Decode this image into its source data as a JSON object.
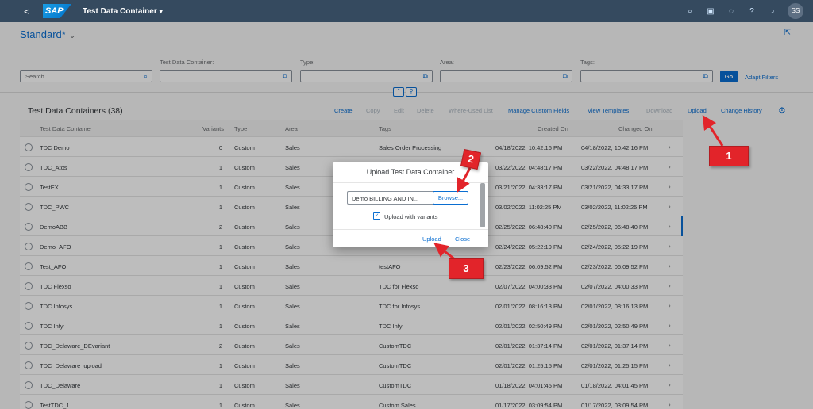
{
  "shell": {
    "back_label": "<",
    "logo_text": "SAP",
    "app_title": "Test Data Container",
    "app_title_caret": "▾",
    "icons": [
      "search-icon",
      "copilot-icon",
      "help-icon",
      "question-icon",
      "notification-icon"
    ],
    "avatar": "SS"
  },
  "header": {
    "variant": "Standard*",
    "variant_chevron": "⌄"
  },
  "filters": {
    "search_placeholder": "Search",
    "labels": [
      "Test Data Container:",
      "Type:",
      "Area:",
      "Tags:"
    ],
    "go": "Go",
    "adapt": "Adapt Filters"
  },
  "table": {
    "title": "Test Data Containers (38)",
    "toolbar": [
      {
        "label": "Create",
        "enabled": true
      },
      {
        "label": "Copy",
        "enabled": false
      },
      {
        "label": "Edit",
        "enabled": false
      },
      {
        "label": "Delete",
        "enabled": false
      },
      {
        "label": "Where-Used List",
        "enabled": false
      },
      {
        "label": "Manage Custom Fields",
        "enabled": true
      },
      {
        "label": "View Templates",
        "enabled": true
      },
      {
        "label": "Download",
        "enabled": false
      },
      {
        "label": "Upload",
        "enabled": true
      },
      {
        "label": "Change History",
        "enabled": true
      }
    ],
    "columns": [
      "Test Data Container",
      "Variants",
      "Type",
      "Area",
      "Tags",
      "Created On",
      "Changed On"
    ],
    "rows": [
      {
        "name": "TDC Demo",
        "variants": "0",
        "type": "Custom",
        "area": "Sales",
        "tags": "Sales Order Processing",
        "created": "04/18/2022, 10:42:16 PM",
        "changed": "04/18/2022, 10:42:16 PM"
      },
      {
        "name": "TDC_Atos",
        "variants": "1",
        "type": "Custom",
        "area": "Sales",
        "tags": "",
        "created": "03/22/2022, 04:48:17 PM",
        "changed": "03/22/2022, 04:48:17 PM"
      },
      {
        "name": "TestEX",
        "variants": "1",
        "type": "Custom",
        "area": "Sales",
        "tags": "",
        "created": "03/21/2022, 04:33:17 PM",
        "changed": "03/21/2022, 04:33:17 PM"
      },
      {
        "name": "TDC_PWC",
        "variants": "1",
        "type": "Custom",
        "area": "Sales",
        "tags": "",
        "created": "03/02/2022, 11:02:25 PM",
        "changed": "03/02/2022, 11:02:25 PM"
      },
      {
        "name": "DemoABB",
        "variants": "2",
        "type": "Custom",
        "area": "Sales",
        "tags": "",
        "created": "02/25/2022, 06:48:40 PM",
        "changed": "02/25/2022, 06:48:40 PM"
      },
      {
        "name": "Demo_AFO",
        "variants": "1",
        "type": "Custom",
        "area": "Sales",
        "tags": "",
        "created": "02/24/2022, 05:22:19 PM",
        "changed": "02/24/2022, 05:22:19 PM"
      },
      {
        "name": "Test_AFO",
        "variants": "1",
        "type": "Custom",
        "area": "Sales",
        "tags": "testAFO",
        "created": "02/23/2022, 06:09:52 PM",
        "changed": "02/23/2022, 06:09:52 PM"
      },
      {
        "name": "TDC Flexso",
        "variants": "1",
        "type": "Custom",
        "area": "Sales",
        "tags": "TDC for Flexso",
        "created": "02/07/2022, 04:00:33 PM",
        "changed": "02/07/2022, 04:00:33 PM"
      },
      {
        "name": "TDC Infosys",
        "variants": "1",
        "type": "Custom",
        "area": "Sales",
        "tags": "TDC for Infosys",
        "created": "02/01/2022, 08:16:13 PM",
        "changed": "02/01/2022, 08:16:13 PM"
      },
      {
        "name": "TDC Infy",
        "variants": "1",
        "type": "Custom",
        "area": "Sales",
        "tags": "TDC Infy",
        "created": "02/01/2022, 02:50:49 PM",
        "changed": "02/01/2022, 02:50:49 PM"
      },
      {
        "name": "TDC_Delaware_DEvariant",
        "variants": "2",
        "type": "Custom",
        "area": "Sales",
        "tags": "CustomTDC",
        "created": "02/01/2022, 01:37:14 PM",
        "changed": "02/01/2022, 01:37:14 PM"
      },
      {
        "name": "TDC_Delaware_upload",
        "variants": "1",
        "type": "Custom",
        "area": "Sales",
        "tags": "CustomTDC",
        "created": "02/01/2022, 01:25:15 PM",
        "changed": "02/01/2022, 01:25:15 PM"
      },
      {
        "name": "TDC_Delaware",
        "variants": "1",
        "type": "Custom",
        "area": "Sales",
        "tags": "CustomTDC",
        "created": "01/18/2022, 04:01:45 PM",
        "changed": "01/18/2022, 04:01:45 PM"
      },
      {
        "name": "TestTDC_1",
        "variants": "1",
        "type": "Custom",
        "area": "Sales",
        "tags": "Custom Sales",
        "created": "01/17/2022, 03:09:54 PM",
        "changed": "01/17/2022, 03:09:54 PM"
      }
    ]
  },
  "dialog": {
    "title": "Upload Test Data Container",
    "file_value": "Demo BILLING AND IN...",
    "browse": "Browse...",
    "checkbox_label": "Upload with variants",
    "checkbox_checked": true,
    "upload": "Upload",
    "close": "Close"
  },
  "callouts": [
    "1",
    "2",
    "3"
  ],
  "colors": {
    "shell": "#354a5f",
    "accent": "#0a6ed1",
    "callout": "#e2242a"
  }
}
